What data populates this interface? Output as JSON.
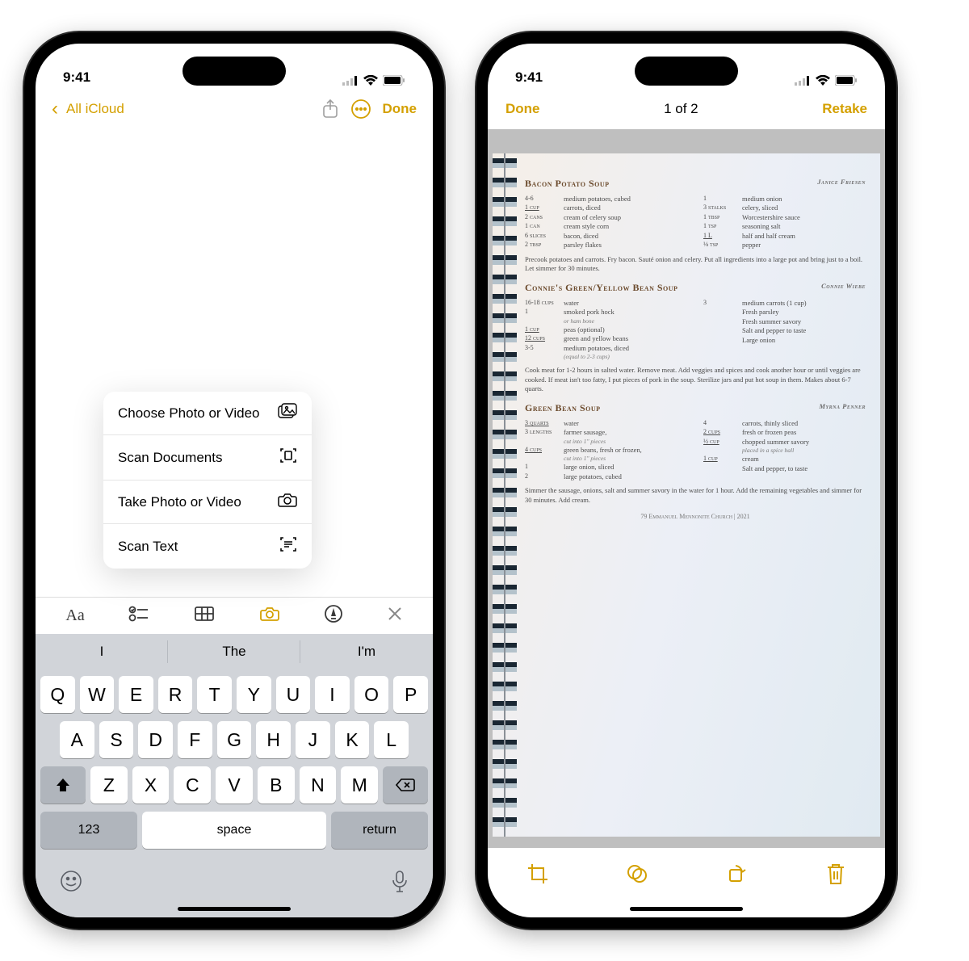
{
  "status": {
    "time": "9:41"
  },
  "phone1": {
    "nav": {
      "back": "All iCloud",
      "done": "Done"
    },
    "menu": {
      "choose": "Choose Photo or Video",
      "scan_doc": "Scan Documents",
      "take": "Take Photo or Video",
      "scan_text": "Scan Text"
    },
    "suggestions": {
      "s1": "I",
      "s2": "The",
      "s3": "I'm"
    },
    "keyboard": {
      "row1": [
        "Q",
        "W",
        "E",
        "R",
        "T",
        "Y",
        "U",
        "I",
        "O",
        "P"
      ],
      "row2": [
        "A",
        "S",
        "D",
        "F",
        "G",
        "H",
        "J",
        "K",
        "L"
      ],
      "row3": [
        "Z",
        "X",
        "C",
        "V",
        "B",
        "N",
        "M"
      ],
      "num": "123",
      "space": "space",
      "return": "return"
    }
  },
  "phone2": {
    "nav": {
      "done": "Done",
      "counter": "1 of 2",
      "retake": "Retake"
    },
    "recipes": {
      "r1": {
        "title": "Bacon Potato Soup",
        "by": "Janice Friesen",
        "colA": [
          {
            "amt": "4-6",
            "txt": "medium potatoes, cubed"
          },
          {
            "amt": "1 cup",
            "txt": "carrots, diced",
            "u": true
          },
          {
            "amt": "2 cans",
            "txt": "cream of celery soup"
          },
          {
            "amt": "1 can",
            "txt": "cream style corn"
          },
          {
            "amt": "6 slices",
            "txt": "bacon, diced"
          },
          {
            "amt": "2 tbsp",
            "txt": "parsley flakes"
          }
        ],
        "colB": [
          {
            "amt": "1",
            "txt": "medium onion"
          },
          {
            "amt": "3 stalks",
            "txt": "celery, sliced"
          },
          {
            "amt": "1 tbsp",
            "txt": "Worcestershire sauce"
          },
          {
            "amt": "1 tsp",
            "txt": "seasoning salt"
          },
          {
            "amt": "1 L",
            "txt": "half and half cream",
            "u": true
          },
          {
            "amt": "⅛ tsp",
            "txt": "pepper"
          }
        ],
        "instr": "Precook potatoes and carrots. Fry bacon. Sauté onion and celery. Put all ingredients into a large pot and bring just to a boil. Let simmer for 30 minutes."
      },
      "r2": {
        "title": "Connie's Green/Yellow Bean Soup",
        "by": "Connie Wiebe",
        "colA": [
          {
            "amt": "16-18 cups",
            "txt": "water"
          },
          {
            "amt": "1",
            "txt": "smoked pork hock",
            "sub": "or ham bone"
          },
          {
            "amt": "1 cup",
            "txt": "peas (optional)",
            "u": true
          },
          {
            "amt": "12 cups",
            "txt": "green and yellow beans",
            "u": true
          },
          {
            "amt": "3-5",
            "txt": "medium potatoes, diced",
            "sub": "(equal to 2-3 cups)"
          }
        ],
        "colB": [
          {
            "amt": "3",
            "txt": "medium carrots (1 cup)"
          },
          {
            "amt": "",
            "txt": "Fresh parsley"
          },
          {
            "amt": "",
            "txt": "Fresh summer savory"
          },
          {
            "amt": "",
            "txt": "Salt and pepper to taste"
          },
          {
            "amt": "",
            "txt": "Large onion"
          }
        ],
        "instr": "Cook meat for 1-2 hours in salted water. Remove meat. Add veggies and spices and cook another hour or until veggies are cooked. If meat isn't too fatty, I put pieces of pork in the soup. Sterilize jars and put hot soup in them. Makes about 6-7 quarts."
      },
      "r3": {
        "title": "Green Bean Soup",
        "by": "Myrna Penner",
        "colA": [
          {
            "amt": "3 quarts",
            "txt": "water",
            "u": true
          },
          {
            "amt": "3 lengths",
            "txt": "farmer sausage,",
            "sub": "cut into 1\" pieces"
          },
          {
            "amt": "4 cups",
            "txt": "green beans, fresh or frozen,",
            "u": true,
            "sub": "cut into 1\" pieces"
          },
          {
            "amt": "1",
            "txt": "large onion, sliced"
          },
          {
            "amt": "2",
            "txt": "large potatoes, cubed"
          }
        ],
        "colB": [
          {
            "amt": "4",
            "txt": "carrots, thinly sliced"
          },
          {
            "amt": "2 cups",
            "txt": "fresh or frozen peas",
            "u": true
          },
          {
            "amt": "½ cup",
            "txt": "chopped summer savory",
            "u": true,
            "sub": "placed in a spice ball"
          },
          {
            "amt": "1 cup",
            "txt": "cream",
            "u": true
          },
          {
            "amt": "",
            "txt": "Salt and pepper, to taste"
          }
        ],
        "instr": "Simmer the sausage, onions, salt and summer savory in the water for 1 hour. Add the remaining vegetables and simmer for 30 minutes. Add cream."
      }
    },
    "page_foot": "79        Emmanuel Mennonite Church  |  2021"
  }
}
